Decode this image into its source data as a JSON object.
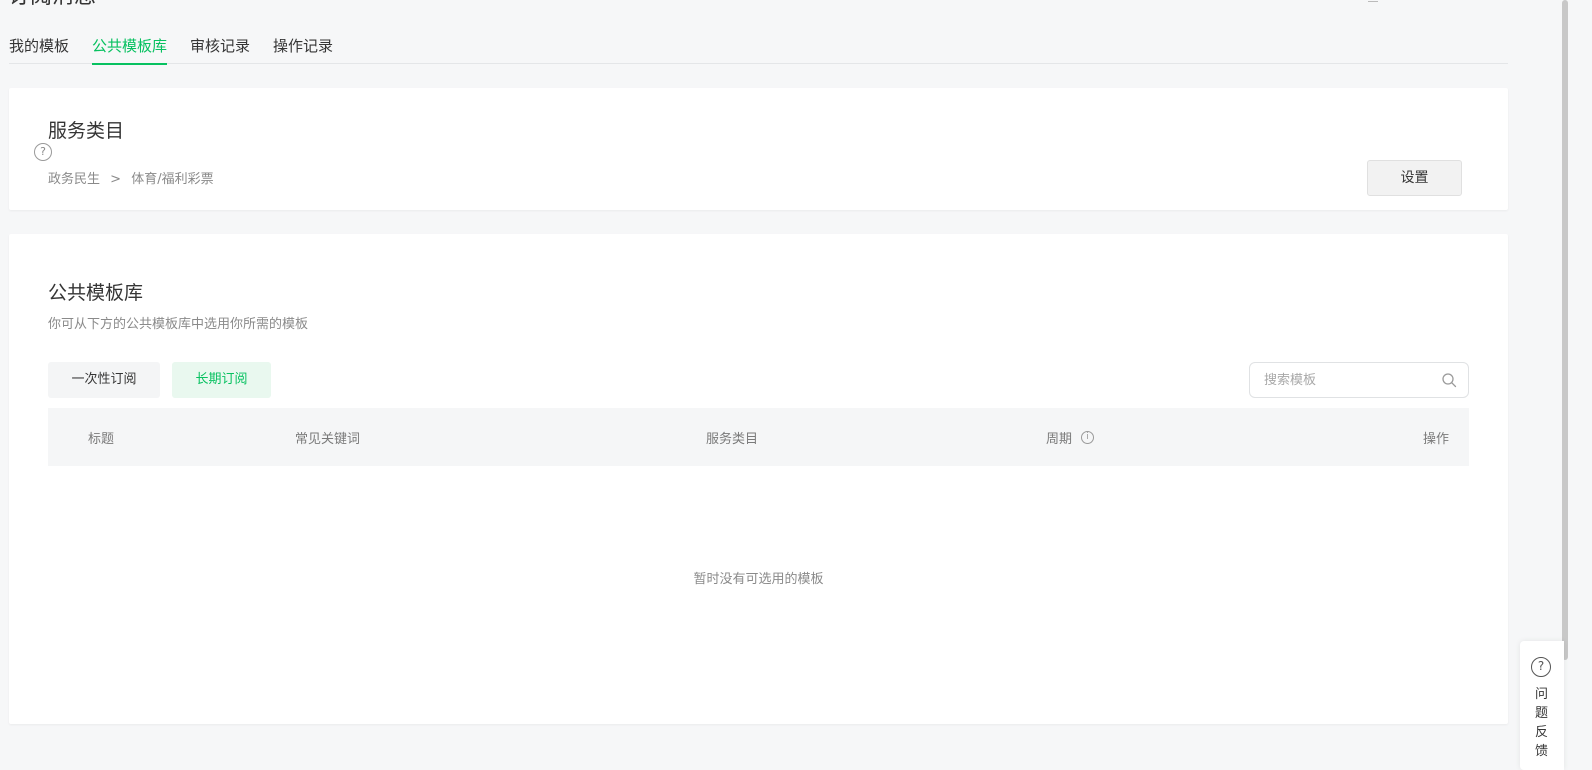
{
  "page": {
    "title": "订阅消息"
  },
  "tabs": [
    {
      "label": "我的模板"
    },
    {
      "label": "公共模板库"
    },
    {
      "label": "审核记录"
    },
    {
      "label": "操作记录"
    }
  ],
  "service_category": {
    "title": "服务类目",
    "help_icon": "question-circle-icon",
    "breadcrumb": {
      "level1": "政务民生",
      "separator": ">",
      "level2": "体育/福利彩票"
    },
    "settings_button": "设置"
  },
  "library": {
    "title": "公共模板库",
    "description": "你可从下方的公共模板库中选用你所需的模板",
    "filters": {
      "once": "一次性订阅",
      "long_term": "长期订阅"
    },
    "search": {
      "placeholder": "搜索模板",
      "value": ""
    },
    "columns": {
      "title": "标题",
      "keywords": "常见关键词",
      "category": "服务类目",
      "period": "周期",
      "action": "操作"
    },
    "empty_text": "暂时没有可选用的模板"
  },
  "feedback": {
    "label": "问题反馈"
  },
  "colors": {
    "accent": "#07c160",
    "background": "#f6f7f8"
  }
}
